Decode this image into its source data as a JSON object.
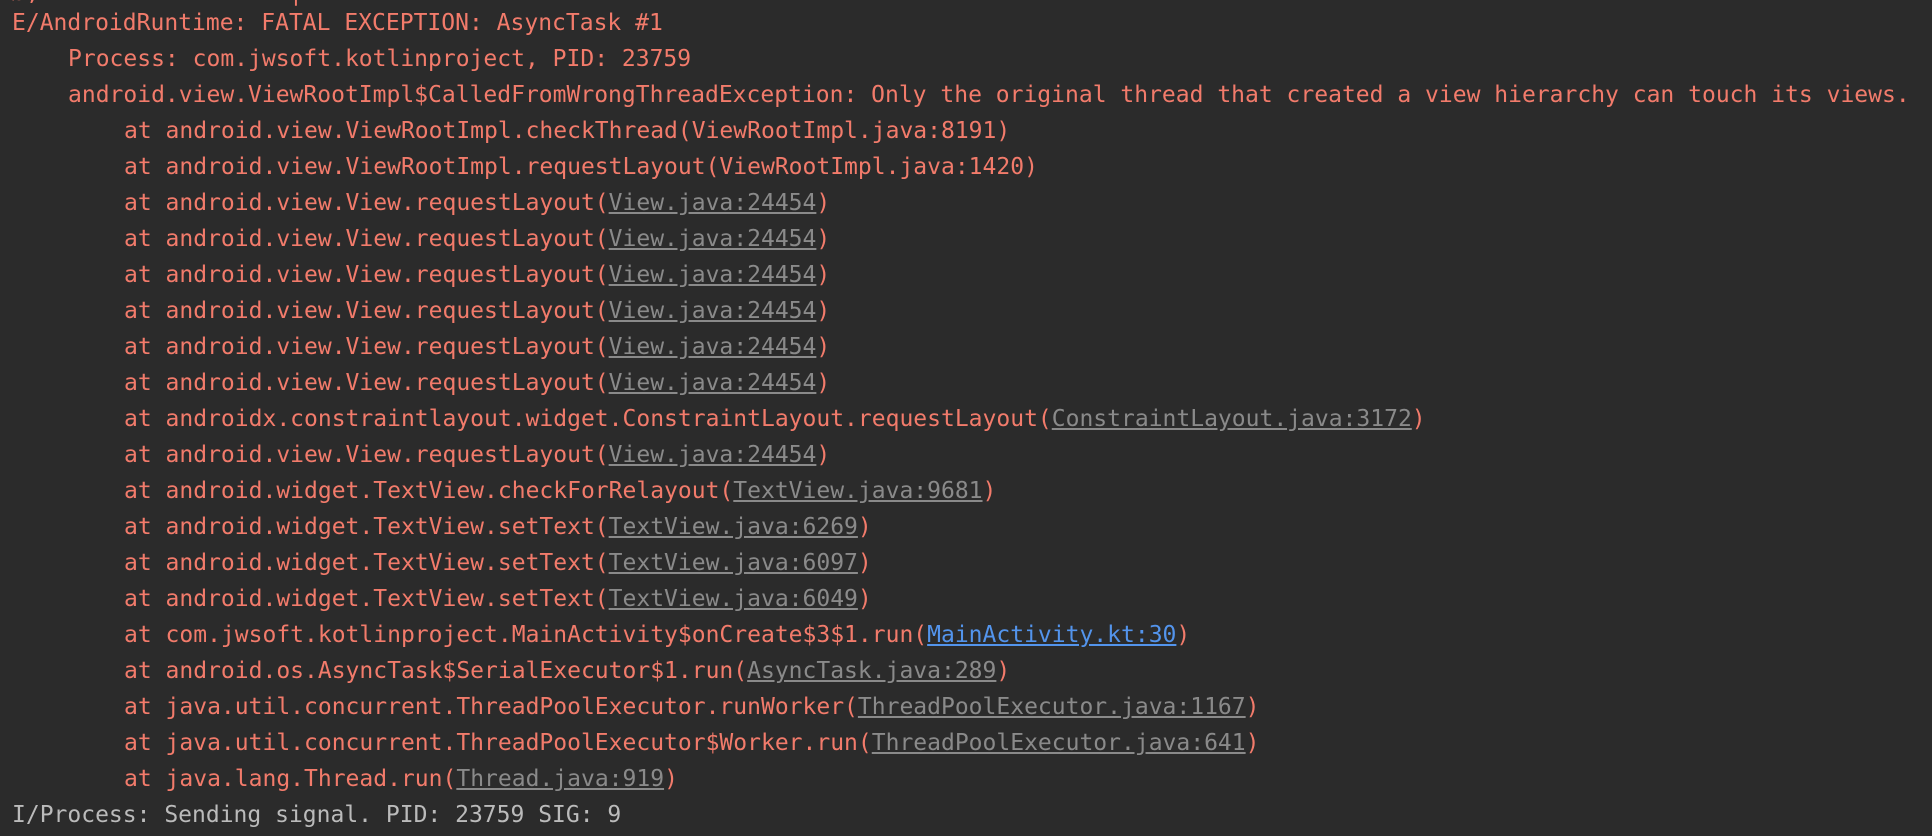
{
  "colors": {
    "background": "#2b2b2b",
    "error_text": "#f27b6b",
    "link_gray": "#8a8a8a",
    "link_blue": "#5394ec",
    "info_text": "#bbbbbb"
  },
  "log": {
    "partial_top_line": "Ø,                  |",
    "exception_header": "E/AndroidRuntime: FATAL EXCEPTION: AsyncTask #1",
    "process_line": "Process: com.jwsoft.kotlinproject, PID: 23759",
    "exception_message": "android.view.ViewRootImpl$CalledFromWrongThreadException: Only the original thread that created a view hierarchy can touch its views.",
    "frames": [
      {
        "prefix": "at android.view.ViewRootImpl.checkThread(ViewRootImpl.java:8191)",
        "link": "",
        "suffix": ""
      },
      {
        "prefix": "at android.view.ViewRootImpl.requestLayout(ViewRootImpl.java:1420)",
        "link": "",
        "suffix": ""
      },
      {
        "prefix": "at android.view.View.requestLayout(",
        "link": "View.java:24454",
        "suffix": ")"
      },
      {
        "prefix": "at android.view.View.requestLayout(",
        "link": "View.java:24454",
        "suffix": ")"
      },
      {
        "prefix": "at android.view.View.requestLayout(",
        "link": "View.java:24454",
        "suffix": ")"
      },
      {
        "prefix": "at android.view.View.requestLayout(",
        "link": "View.java:24454",
        "suffix": ")"
      },
      {
        "prefix": "at android.view.View.requestLayout(",
        "link": "View.java:24454",
        "suffix": ")"
      },
      {
        "prefix": "at android.view.View.requestLayout(",
        "link": "View.java:24454",
        "suffix": ")"
      },
      {
        "prefix": "at androidx.constraintlayout.widget.ConstraintLayout.requestLayout(",
        "link": "ConstraintLayout.java:3172",
        "suffix": ")"
      },
      {
        "prefix": "at android.view.View.requestLayout(",
        "link": "View.java:24454",
        "suffix": ")"
      },
      {
        "prefix": "at android.widget.TextView.checkForRelayout(",
        "link": "TextView.java:9681",
        "suffix": ")"
      },
      {
        "prefix": "at android.widget.TextView.setText(",
        "link": "TextView.java:6269",
        "suffix": ")"
      },
      {
        "prefix": "at android.widget.TextView.setText(",
        "link": "TextView.java:6097",
        "suffix": ")"
      },
      {
        "prefix": "at android.widget.TextView.setText(",
        "link": "TextView.java:6049",
        "suffix": ")"
      },
      {
        "prefix": "at com.jwsoft.kotlinproject.MainActivity$onCreate$3$1.run(",
        "link": "MainActivity.kt:30",
        "suffix": ")"
      },
      {
        "prefix": "at android.os.AsyncTask$SerialExecutor$1.run(",
        "link": "AsyncTask.java:289",
        "suffix": ")"
      },
      {
        "prefix": "at java.util.concurrent.ThreadPoolExecutor.runWorker(",
        "link": "ThreadPoolExecutor.java:1167",
        "suffix": ")"
      },
      {
        "prefix": "at java.util.concurrent.ThreadPoolExecutor$Worker.run(",
        "link": "ThreadPoolExecutor.java:641",
        "suffix": ")"
      },
      {
        "prefix": "at java.lang.Thread.run(",
        "link": "Thread.java:919",
        "suffix": ")"
      }
    ],
    "footer": "I/Process: Sending signal. PID: 23759 SIG: 9"
  }
}
